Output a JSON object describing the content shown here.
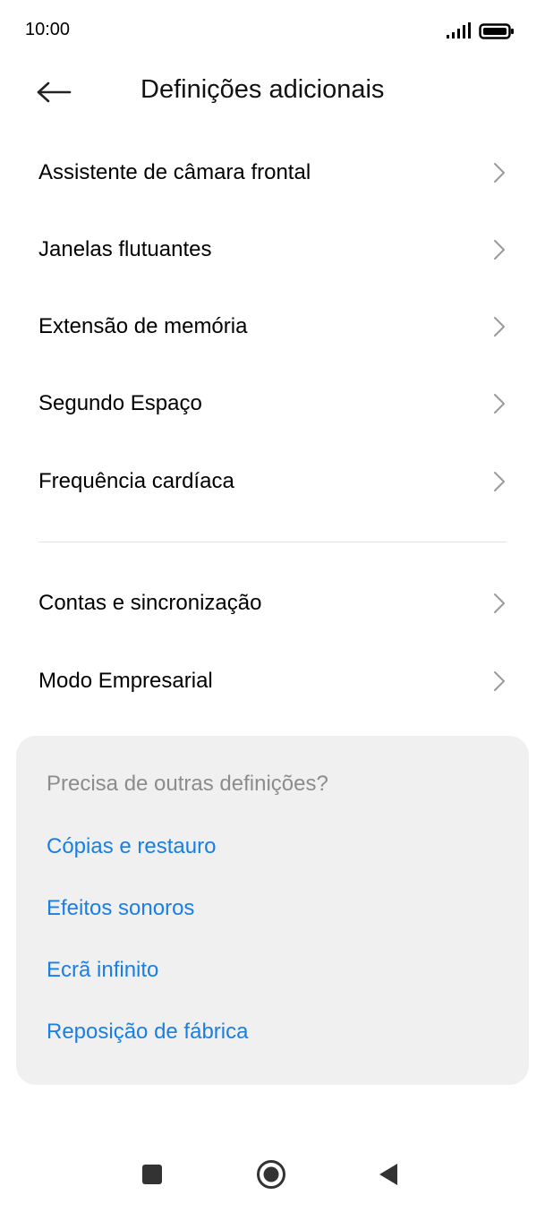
{
  "status_bar": {
    "time": "10:00",
    "signal_icon": "signal-bars-icon",
    "battery_icon": "battery-full-icon"
  },
  "header": {
    "title": "Definições adicionais",
    "back_icon": "arrow-left-icon"
  },
  "list": {
    "group1": [
      {
        "label": "Assistente de câmara frontal",
        "icon": "chevron-right-icon"
      },
      {
        "label": "Janelas flutuantes",
        "icon": "chevron-right-icon"
      },
      {
        "label": "Extensão de memória",
        "icon": "chevron-right-icon"
      },
      {
        "label": "Segundo Espaço",
        "icon": "chevron-right-icon"
      },
      {
        "label": "Frequência cardíaca",
        "icon": "chevron-right-icon"
      }
    ],
    "group2": [
      {
        "label": "Contas e sincronização",
        "icon": "chevron-right-icon"
      },
      {
        "label": "Modo Empresarial",
        "icon": "chevron-right-icon"
      }
    ]
  },
  "suggestions": {
    "title": "Precisa de outras definições?",
    "links": [
      "Cópias e restauro",
      "Efeitos sonoros",
      "Ecrã infinito",
      "Reposição de fábrica"
    ]
  },
  "nav_bar": {
    "recents_icon": "square-recents-icon",
    "home_icon": "circle-home-icon",
    "back_icon": "triangle-back-icon"
  },
  "colors": {
    "link": "#1a7ee5",
    "card_background": "#f0f0f0",
    "muted_text": "#8c8c8c",
    "chevron": "#9a9a9a",
    "nav_icons": "#333333"
  }
}
